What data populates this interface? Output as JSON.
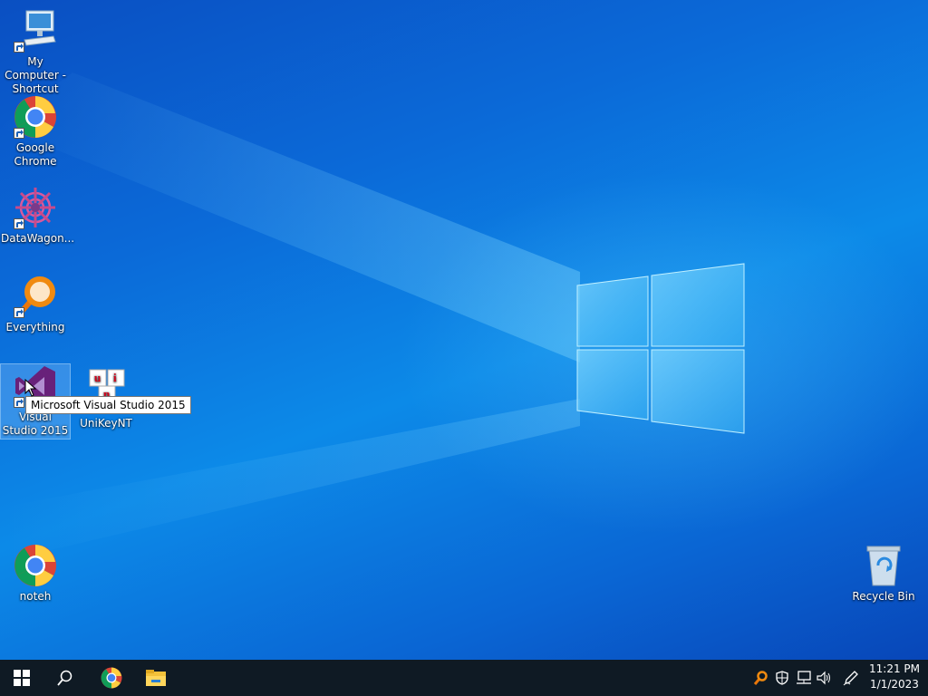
{
  "desktop": {
    "icons": [
      {
        "label": "My Computer - Shortcut"
      },
      {
        "label": "Google Chrome"
      },
      {
        "label": "DataWagon..."
      },
      {
        "label": "Everything"
      },
      {
        "label": "Visual Studio 2015"
      },
      {
        "label": "UniKeyNT"
      },
      {
        "label": "noteh"
      },
      {
        "label": "Recycle Bin"
      }
    ],
    "tooltip": "Microsoft Visual Studio 2015"
  },
  "taskbar": {
    "clock_time": "11:21 PM",
    "clock_date": "1/1/2023"
  },
  "colors": {
    "taskbar": "#0f1a24",
    "accent": "#0a6fd8"
  }
}
